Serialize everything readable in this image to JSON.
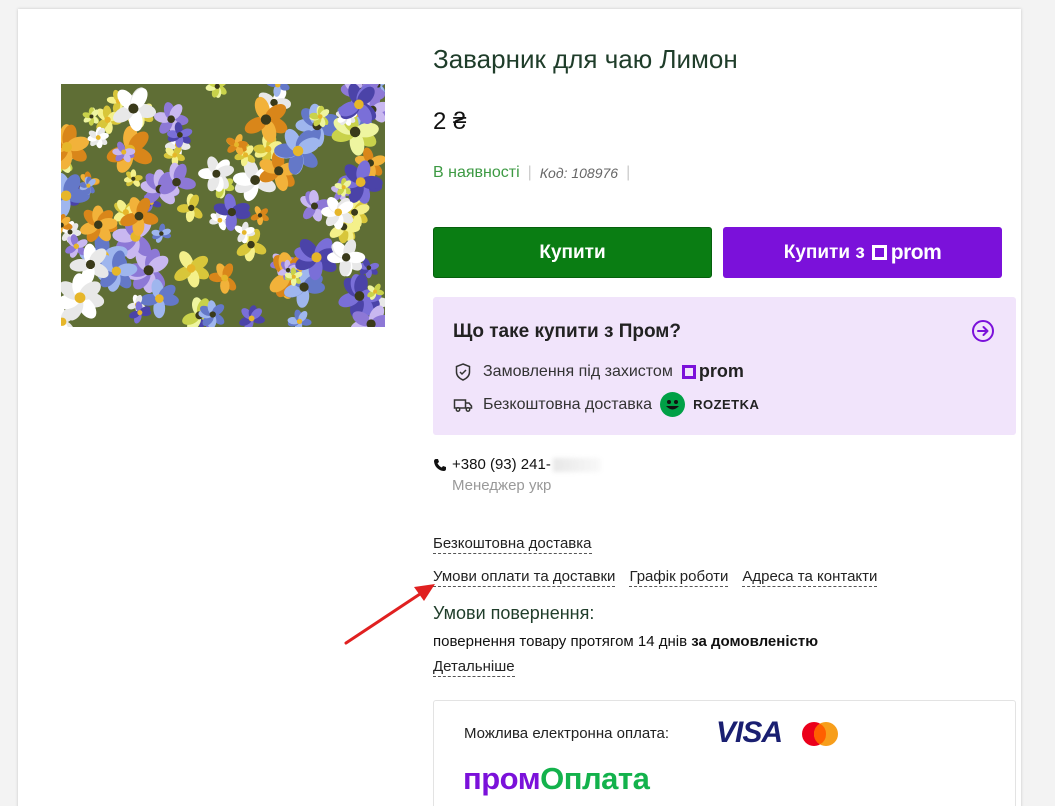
{
  "product": {
    "title": "Заварник для чаю Лимон",
    "price": "2 ₴",
    "availability": "В наявності",
    "code": "Код: 108976"
  },
  "buttons": {
    "buy_label": "Купити",
    "buy_prom_label": "Купити з",
    "prom_word": "prom"
  },
  "prom_info": {
    "title": "Що таке купити з Пром?",
    "feature_protection": "Замовлення під захистом",
    "feature_delivery": "Безкоштовна доставка",
    "prom_word": "prom",
    "rozetka_word": "ROZETKA"
  },
  "contact": {
    "phone": "+380 (93) 241-",
    "manager": "Менеджер укр"
  },
  "links": {
    "free_delivery": "Безкоштовна доставка",
    "payment_delivery": "Умови оплати та доставки",
    "schedule": "Графік роботи",
    "address": "Адреса та контакти"
  },
  "returns": {
    "title": "Умови повернення:",
    "text": "повернення товару протягом 14 днів",
    "text_bold": "за домовленістю",
    "details_link": "Детальніше"
  },
  "payment": {
    "label": "Можлива електронна оплата:",
    "visa": "VISA",
    "prom_oplata_part1": "пром",
    "prom_oplata_part2": "Оплата"
  },
  "colors": {
    "buy_green": "#0a7d13",
    "prom_purple": "#7b11da",
    "prom_box_bg": "#f1e4fb",
    "in_stock_green": "#3d9a43",
    "oplata_green": "#13b24c",
    "annotation_red": "#e02020"
  }
}
